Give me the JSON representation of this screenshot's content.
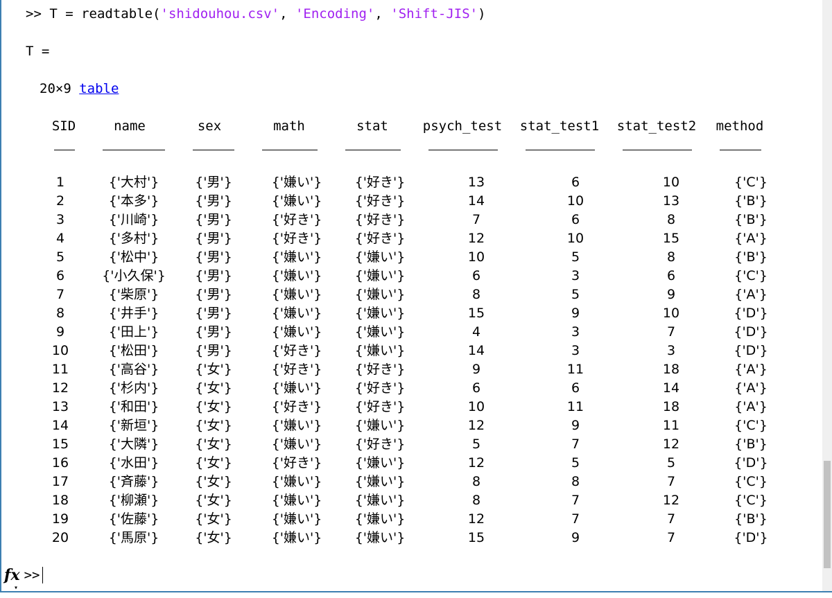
{
  "command": {
    "prompt": ">>",
    "code_prefix": "T = readtable(",
    "arg1": "'shidouhou.csv'",
    "sep1": ", ",
    "arg2": "'Encoding'",
    "sep2": ", ",
    "arg3": "'Shift-JIS'",
    "code_suffix": ")"
  },
  "output": {
    "var_line": "T =",
    "size_text": "20×9",
    "size_link": "table"
  },
  "table": {
    "columns": [
      "SID",
      "name",
      "sex",
      "math",
      "stat",
      "psych_test",
      "stat_test1",
      "stat_test2",
      "method"
    ],
    "rows": [
      [
        "1",
        "{'大村'}",
        "{'男'}",
        "{'嫌い'}",
        "{'好き'}",
        "13",
        "6",
        "10",
        "{'C'}"
      ],
      [
        "2",
        "{'本多'}",
        "{'男'}",
        "{'嫌い'}",
        "{'好き'}",
        "14",
        "10",
        "13",
        "{'B'}"
      ],
      [
        "3",
        "{'川崎'}",
        "{'男'}",
        "{'好き'}",
        "{'好き'}",
        "7",
        "6",
        "8",
        "{'B'}"
      ],
      [
        "4",
        "{'多村'}",
        "{'男'}",
        "{'好き'}",
        "{'好き'}",
        "12",
        "10",
        "15",
        "{'A'}"
      ],
      [
        "5",
        "{'松中'}",
        "{'男'}",
        "{'嫌い'}",
        "{'嫌い'}",
        "10",
        "5",
        "8",
        "{'B'}"
      ],
      [
        "6",
        "{'小久保'}",
        "{'男'}",
        "{'嫌い'}",
        "{'嫌い'}",
        "6",
        "3",
        "6",
        "{'C'}"
      ],
      [
        "7",
        "{'柴原'}",
        "{'男'}",
        "{'嫌い'}",
        "{'嫌い'}",
        "8",
        "5",
        "9",
        "{'A'}"
      ],
      [
        "8",
        "{'井手'}",
        "{'男'}",
        "{'嫌い'}",
        "{'嫌い'}",
        "15",
        "9",
        "10",
        "{'D'}"
      ],
      [
        "9",
        "{'田上'}",
        "{'男'}",
        "{'嫌い'}",
        "{'嫌い'}",
        "4",
        "3",
        "7",
        "{'D'}"
      ],
      [
        "10",
        "{'松田'}",
        "{'男'}",
        "{'好き'}",
        "{'嫌い'}",
        "14",
        "3",
        "3",
        "{'D'}"
      ],
      [
        "11",
        "{'高谷'}",
        "{'女'}",
        "{'好き'}",
        "{'好き'}",
        "9",
        "11",
        "18",
        "{'A'}"
      ],
      [
        "12",
        "{'杉内'}",
        "{'女'}",
        "{'嫌い'}",
        "{'好き'}",
        "6",
        "6",
        "14",
        "{'A'}"
      ],
      [
        "13",
        "{'和田'}",
        "{'女'}",
        "{'好き'}",
        "{'好き'}",
        "10",
        "11",
        "18",
        "{'A'}"
      ],
      [
        "14",
        "{'新垣'}",
        "{'女'}",
        "{'嫌い'}",
        "{'嫌い'}",
        "12",
        "9",
        "11",
        "{'C'}"
      ],
      [
        "15",
        "{'大隣'}",
        "{'女'}",
        "{'嫌い'}",
        "{'好き'}",
        "5",
        "7",
        "12",
        "{'B'}"
      ],
      [
        "16",
        "{'水田'}",
        "{'女'}",
        "{'好き'}",
        "{'嫌い'}",
        "12",
        "5",
        "5",
        "{'D'}"
      ],
      [
        "17",
        "{'斉藤'}",
        "{'女'}",
        "{'嫌い'}",
        "{'嫌い'}",
        "8",
        "8",
        "7",
        "{'C'}"
      ],
      [
        "18",
        "{'柳瀬'}",
        "{'女'}",
        "{'嫌い'}",
        "{'嫌い'}",
        "8",
        "7",
        "12",
        "{'C'}"
      ],
      [
        "19",
        "{'佐藤'}",
        "{'女'}",
        "{'嫌い'}",
        "{'嫌い'}",
        "12",
        "7",
        "7",
        "{'B'}"
      ],
      [
        "20",
        "{'馬原'}",
        "{'女'}",
        "{'嫌い'}",
        "{'嫌い'}",
        "15",
        "9",
        "7",
        "{'D'}"
      ]
    ]
  },
  "prompt_line": {
    "fx_icon": "fx",
    "chevron_icon": "chevron-down-icon",
    "prompt": ">>"
  },
  "colors": {
    "string": "#a020f0",
    "link": "#0000ee",
    "frame": "#3c7fb1"
  }
}
